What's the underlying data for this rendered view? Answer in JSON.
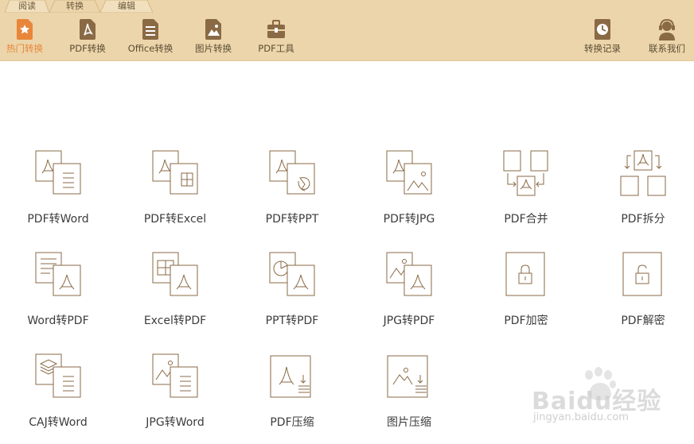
{
  "tabs": [
    {
      "label": "阅读"
    },
    {
      "label": "转换"
    },
    {
      "label": "编辑"
    }
  ],
  "toolbar": {
    "items": [
      {
        "label": "热门转换",
        "icon": "hot-star-icon"
      },
      {
        "label": "PDF转换",
        "icon": "pdf-file-icon"
      },
      {
        "label": "Office转换",
        "icon": "office-document-icon"
      },
      {
        "label": "图片转换",
        "icon": "image-file-icon"
      },
      {
        "label": "PDF工具",
        "icon": "toolbox-icon"
      }
    ],
    "right_items": [
      {
        "label": "转换记录",
        "icon": "clock-history-icon"
      },
      {
        "label": "联系我们",
        "icon": "headset-icon"
      }
    ]
  },
  "tools": [
    {
      "label": "PDF转Word",
      "icon": "pdf-to-word-icon"
    },
    {
      "label": "PDF转Excel",
      "icon": "pdf-to-excel-icon"
    },
    {
      "label": "PDF转PPT",
      "icon": "pdf-to-ppt-icon"
    },
    {
      "label": "PDF转JPG",
      "icon": "pdf-to-jpg-icon"
    },
    {
      "label": "PDF合并",
      "icon": "pdf-merge-icon"
    },
    {
      "label": "PDF拆分",
      "icon": "pdf-split-icon"
    },
    {
      "label": "Word转PDF",
      "icon": "word-to-pdf-icon"
    },
    {
      "label": "Excel转PDF",
      "icon": "excel-to-pdf-icon"
    },
    {
      "label": "PPT转PDF",
      "icon": "ppt-to-pdf-icon"
    },
    {
      "label": "JPG转PDF",
      "icon": "jpg-to-pdf-icon"
    },
    {
      "label": "PDF加密",
      "icon": "pdf-encrypt-lock-icon"
    },
    {
      "label": "PDF解密",
      "icon": "pdf-decrypt-unlock-icon"
    },
    {
      "label": "CAJ转Word",
      "icon": "caj-to-word-icon"
    },
    {
      "label": "JPG转Word",
      "icon": "jpg-to-word-icon"
    },
    {
      "label": "PDF压缩",
      "icon": "pdf-compress-icon"
    },
    {
      "label": "图片压缩",
      "icon": "image-compress-icon"
    }
  ],
  "watermark": {
    "line1": "Baidu经验",
    "line2": "jingyan.baidu.com"
  },
  "colors": {
    "topbar": "#ecd5aa",
    "accent": "#e8863a",
    "icon_stroke": "#8a6a45"
  }
}
